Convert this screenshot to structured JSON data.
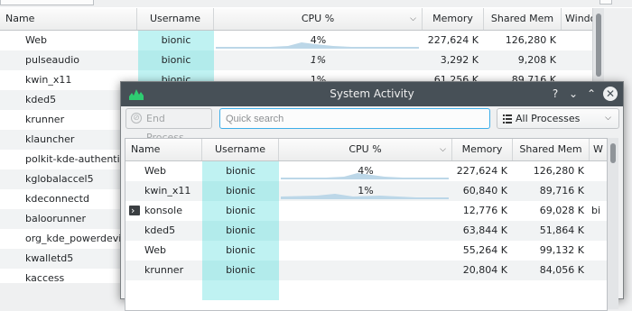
{
  "background": {
    "columns": [
      "Name",
      "Username",
      "CPU %",
      "Memory",
      "Shared Mem",
      "Windo"
    ],
    "rows": [
      {
        "name": "Web",
        "user": "bionic",
        "cpu": "4%",
        "mem": "227,624 K",
        "shared": "126,280 K"
      },
      {
        "name": "pulseaudio",
        "user": "bionic",
        "cpu": "1%",
        "mem": "3,292 K",
        "shared": "9,208 K"
      },
      {
        "name": "kwin_x11",
        "user": "bionic",
        "cpu": "1%",
        "mem": "61,256 K",
        "shared": "89,716 K"
      },
      {
        "name": "kded5",
        "user": "",
        "cpu": "",
        "mem": "",
        "shared": ""
      },
      {
        "name": "krunner",
        "user": "",
        "cpu": "",
        "mem": "",
        "shared": ""
      },
      {
        "name": "klauncher",
        "user": "",
        "cpu": "",
        "mem": "",
        "shared": ""
      },
      {
        "name": "polkit-kde-authentica",
        "user": "",
        "cpu": "",
        "mem": "",
        "shared": ""
      },
      {
        "name": "kglobalaccel5",
        "user": "",
        "cpu": "",
        "mem": "",
        "shared": ""
      },
      {
        "name": "kdeconnectd",
        "user": "",
        "cpu": "",
        "mem": "",
        "shared": ""
      },
      {
        "name": "baloorunner",
        "user": "",
        "cpu": "",
        "mem": "",
        "shared": ""
      },
      {
        "name": "org_kde_powerdevil",
        "user": "",
        "cpu": "",
        "mem": "",
        "shared": ""
      },
      {
        "name": "kwalletd5",
        "user": "",
        "cpu": "",
        "mem": "",
        "shared": ""
      },
      {
        "name": "kaccess",
        "user": "",
        "cpu": "",
        "mem": "",
        "shared": ""
      }
    ]
  },
  "window": {
    "title": "System Activity",
    "buttons": {
      "help": "?",
      "minimize": "⌄",
      "maximize": "⌃",
      "close": "✕"
    },
    "end_process_label": "End Process...",
    "search_placeholder": "Quick search",
    "filter_selected": "All Processes",
    "columns": [
      "Name",
      "Username",
      "CPU %",
      "Memory",
      "Shared Mem",
      "W"
    ],
    "rows": [
      {
        "name": "Web",
        "user": "bionic",
        "cpu": "4%",
        "mem": "227,624 K",
        "shared": "126,280 K",
        "extra": ""
      },
      {
        "name": "kwin_x11",
        "user": "bionic",
        "cpu": "1%",
        "mem": "60,840 K",
        "shared": "89,716 K",
        "extra": ""
      },
      {
        "name": "konsole",
        "user": "bionic",
        "cpu": "",
        "mem": "12,776 K",
        "shared": "69,028 K",
        "extra": "bi"
      },
      {
        "name": "kded5",
        "user": "bionic",
        "cpu": "",
        "mem": "63,844 K",
        "shared": "51,864 K",
        "extra": ""
      },
      {
        "name": "Web",
        "user": "bionic",
        "cpu": "",
        "mem": "55,264 K",
        "shared": "99,132 K",
        "extra": ""
      },
      {
        "name": "krunner",
        "user": "bionic",
        "cpu": "",
        "mem": "20,804 K",
        "shared": "84,056 K",
        "extra": ""
      }
    ]
  },
  "colors": {
    "accent": "#3daee9",
    "titlebar": "#475057",
    "username_cell": "#bff2f2",
    "spark": "#9ec3d9"
  }
}
